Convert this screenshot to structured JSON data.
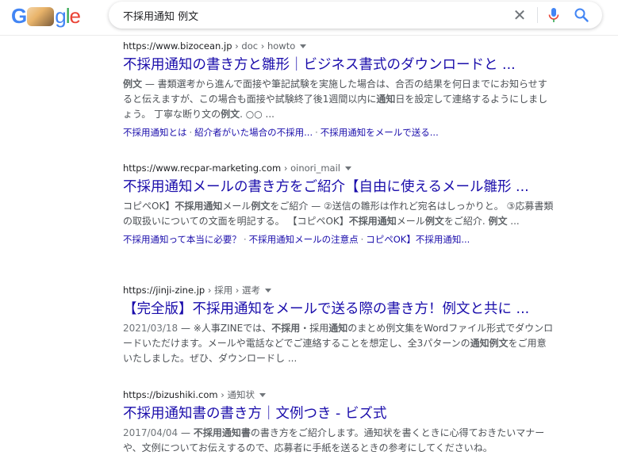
{
  "search": {
    "query": "不採用通知 例文",
    "clear_glyph": "✕"
  },
  "logo": {
    "g": "G",
    "rest_g": "g",
    "rest_l": "l",
    "rest_e": "e"
  },
  "results": [
    {
      "url": "https://www.bizocean.jp",
      "path": " › doc › howto",
      "title": "不採用通知の書き方と雛形｜ビジネス書式のダウンロードと ...",
      "snippet_html": "<b>例文</b> — 書類選考から進んで面接や筆記試験を実施した場合は、合否の結果を何日までにお知らせすると伝えますが、この場合も面接や試験終了後1週間以内に<b>通知</b>日を設定して連絡するようにしましょう。 丁寧な断り文の<b>例文</b>. ○○ ...",
      "sitelinks": [
        "不採用通知とは",
        "紹介者がいた場合の不採用...",
        "不採用通知をメールで送る..."
      ]
    },
    {
      "url": "https://www.recpar-marketing.com",
      "path": " › oinori_mail",
      "title": "不採用通知メールの書き方をご紹介【自由に使えるメール雛形 ...",
      "snippet_html": "コピペOK】<b>不採用通知</b>メール<b>例文</b>をご紹介 — ②送信の雛形は作れど宛名はしっかりと。 ③応募書類の取扱いについての文面を明記する。 【コピペOK】<b>不採用通知</b>メール<b>例文</b>をご紹介. <b>例文</b> ...",
      "sitelinks": [
        "不採用通知って本当に必要？",
        "不採用通知メールの注意点",
        "コピペOK】不採用通知..."
      ]
    },
    {
      "url": "https://jinji-zine.jp",
      "path": " › 採用 › 選考",
      "title": "【完全版】不採用通知をメールで送る際の書き方！例文と共に ...",
      "snippet_html": "<span class=\"date\">2021/03/18</span> — ※人事ZINEでは、<b>不採用</b>・採用<b>通知</b>のまとめ例文集をWordファイル形式でダウンロードいただけます。メールや電話などでご連絡することを想定し、全3パターンの<b>通知例文</b>をご用意いたしました。ぜひ、ダウンロードし ...",
      "sitelinks": []
    },
    {
      "url": "https://bizushiki.com",
      "path": " › 通知状",
      "title": "不採用通知書の書き方｜文例つき - ビズ式",
      "snippet_html": "<span class=\"date\">2017/04/04</span> — <b>不採用通知書</b>の書き方をご紹介します。通知状を書くときに心得ておきたいマナーや、文例についてお伝えするので、応募者に手紙を送るときの参考にしてくださいね。",
      "sitelinks": []
    }
  ]
}
